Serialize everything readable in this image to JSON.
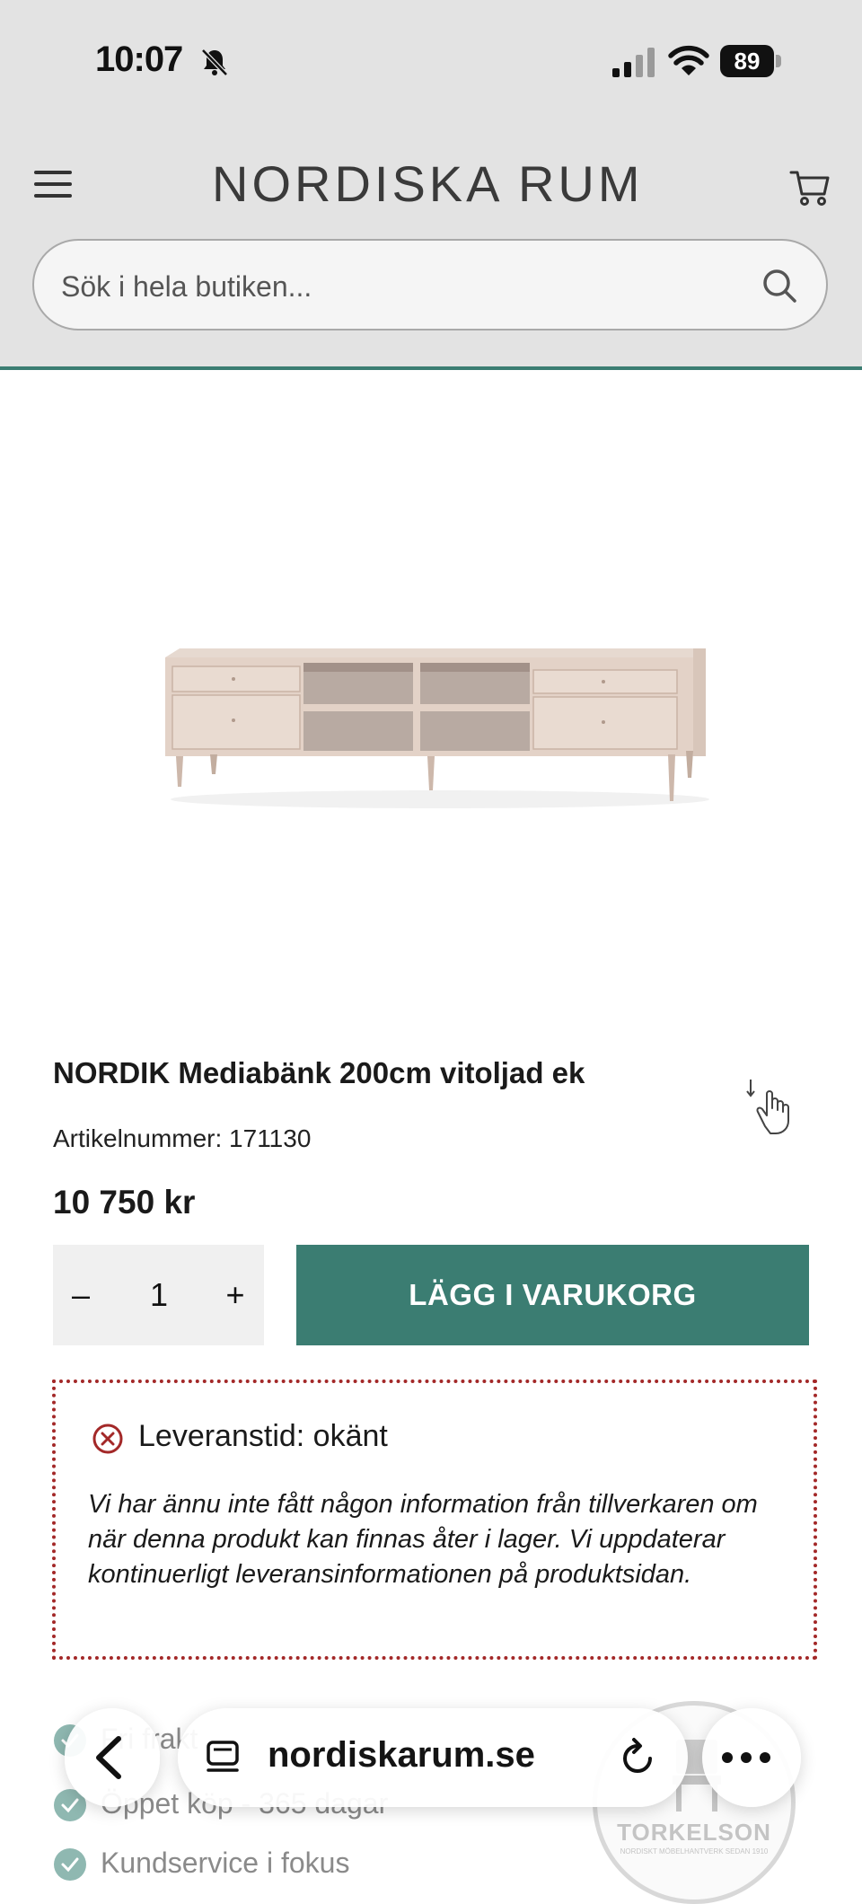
{
  "status_bar": {
    "time": "10:07",
    "battery": "89",
    "icons": [
      "bell-slash-icon",
      "signal-icon",
      "wifi-icon",
      "battery-icon"
    ]
  },
  "header": {
    "logo_text": "NORDISKA RUM",
    "menu_icon": "hamburger-icon",
    "cart_icon": "cart-icon"
  },
  "search": {
    "placeholder": "Sök i hela butiken...",
    "icon": "search-icon"
  },
  "product": {
    "image": "media-bench-image",
    "title": "NORDIK Mediabänk 200cm vitoljad ek",
    "sku_label": "Artikelnummer:",
    "sku_value": "171130",
    "price": "10 750 kr",
    "quantity": "1",
    "qty_minus": "–",
    "qty_plus": "+",
    "add_to_cart": "LÄGG I VARUKORG"
  },
  "delivery": {
    "title": "Leveranstid: okänt",
    "text": "Vi har ännu inte fått någon information från tillverkaren om när denna produkt kan finnas åter i lager. Vi uppdaterar kontinuerligt leveransinformationen på produktsidan."
  },
  "usps": [
    {
      "text": "Fri frakt"
    },
    {
      "text": "Öppet köp - 365 dagar"
    },
    {
      "text": "Kundservice i fokus"
    }
  ],
  "badge": {
    "name": "TORKELSON",
    "tagline": "NORDISKT MÖBELHANTVERK SEDAN 1910"
  },
  "browser": {
    "url": "nordiskarum.se"
  },
  "colors": {
    "brand": "#3b7d72",
    "alert": "#a32828",
    "header_bg": "#e3e3e3"
  }
}
